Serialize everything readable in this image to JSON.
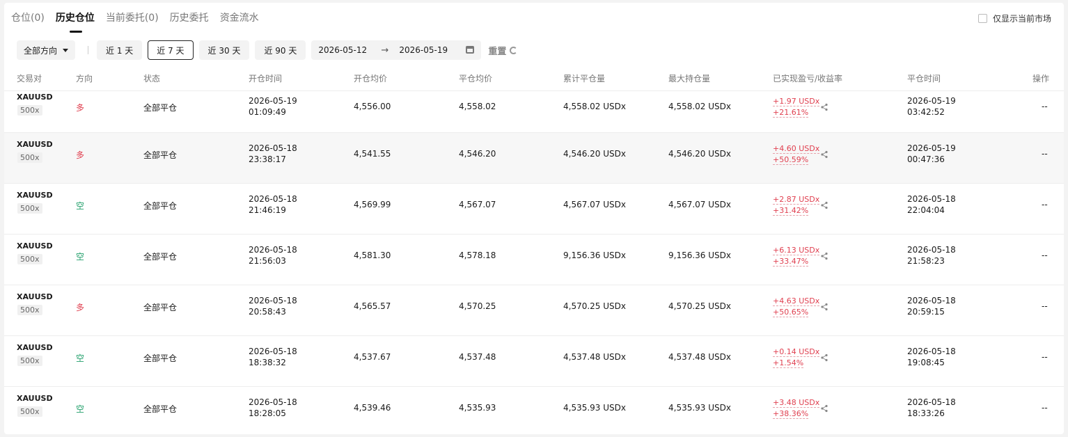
{
  "tabs": [
    {
      "label": "仓位(0)",
      "active": false
    },
    {
      "label": "历史仓位",
      "active": true
    },
    {
      "label": "当前委托(0)",
      "active": false
    },
    {
      "label": "历史委托",
      "active": false
    },
    {
      "label": "资金流水",
      "active": false
    }
  ],
  "only_current_market": {
    "label": "仅显示当前市场",
    "checked": false
  },
  "filters": {
    "direction": "全部方向",
    "ranges": [
      "近 1 天",
      "近 7 天",
      "近 30 天",
      "近 90 天"
    ],
    "active_range": "近 7 天",
    "date_from": "2026-05-12",
    "date_to": "2026-05-19",
    "reset_label": "重置"
  },
  "columns": [
    "交易对",
    "方向",
    "状态",
    "开仓时间",
    "开仓均价",
    "平仓均价",
    "累计平仓量",
    "最大持仓量",
    "已实现盈亏/收益率",
    "平仓时间",
    "操作"
  ],
  "rows": [
    {
      "pair": "XAUUSD",
      "leverage": "500x",
      "side": "多",
      "status": "全部平仓",
      "open_date": "2026-05-19",
      "open_time": "01:09:49",
      "open_price": "4,556.00",
      "close_price": "4,558.02",
      "closed_qty": "4,558.02 USDx",
      "max_qty": "4,558.02 USDx",
      "pnl": "+1.97 USDx",
      "roi": "+21.61%",
      "close_date": "2026-05-19",
      "close_time": "03:42:52",
      "action": "--"
    },
    {
      "pair": "XAUUSD",
      "leverage": "500x",
      "side": "多",
      "status": "全部平仓",
      "open_date": "2026-05-18",
      "open_time": "23:38:17",
      "open_price": "4,541.55",
      "close_price": "4,546.20",
      "closed_qty": "4,546.20 USDx",
      "max_qty": "4,546.20 USDx",
      "pnl": "+4.60 USDx",
      "roi": "+50.59%",
      "close_date": "2026-05-19",
      "close_time": "00:47:36",
      "action": "--"
    },
    {
      "pair": "XAUUSD",
      "leverage": "500x",
      "side": "空",
      "status": "全部平仓",
      "open_date": "2026-05-18",
      "open_time": "21:46:19",
      "open_price": "4,569.99",
      "close_price": "4,567.07",
      "closed_qty": "4,567.07 USDx",
      "max_qty": "4,567.07 USDx",
      "pnl": "+2.87 USDx",
      "roi": "+31.42%",
      "close_date": "2026-05-18",
      "close_time": "22:04:04",
      "action": "--"
    },
    {
      "pair": "XAUUSD",
      "leverage": "500x",
      "side": "空",
      "status": "全部平仓",
      "open_date": "2026-05-18",
      "open_time": "21:56:03",
      "open_price": "4,581.30",
      "close_price": "4,578.18",
      "closed_qty": "9,156.36 USDx",
      "max_qty": "9,156.36 USDx",
      "pnl": "+6.13 USDx",
      "roi": "+33.47%",
      "close_date": "2026-05-18",
      "close_time": "21:58:23",
      "action": "--"
    },
    {
      "pair": "XAUUSD",
      "leverage": "500x",
      "side": "多",
      "status": "全部平仓",
      "open_date": "2026-05-18",
      "open_time": "20:58:43",
      "open_price": "4,565.57",
      "close_price": "4,570.25",
      "closed_qty": "4,570.25 USDx",
      "max_qty": "4,570.25 USDx",
      "pnl": "+4.63 USDx",
      "roi": "+50.65%",
      "close_date": "2026-05-18",
      "close_time": "20:59:15",
      "action": "--"
    },
    {
      "pair": "XAUUSD",
      "leverage": "500x",
      "side": "空",
      "status": "全部平仓",
      "open_date": "2026-05-18",
      "open_time": "18:38:32",
      "open_price": "4,537.67",
      "close_price": "4,537.48",
      "closed_qty": "4,537.48 USDx",
      "max_qty": "4,537.48 USDx",
      "pnl": "+0.14 USDx",
      "roi": "+1.54%",
      "close_date": "2026-05-18",
      "close_time": "19:08:45",
      "action": "--"
    },
    {
      "pair": "XAUUSD",
      "leverage": "500x",
      "side": "空",
      "status": "全部平仓",
      "open_date": "2026-05-18",
      "open_time": "18:28:05",
      "open_price": "4,539.46",
      "close_price": "4,535.93",
      "closed_qty": "4,535.93 USDx",
      "max_qty": "4,535.93 USDx",
      "pnl": "+3.48 USDx",
      "roi": "+38.36%",
      "close_date": "2026-05-18",
      "close_time": "18:33:26",
      "action": "--"
    }
  ],
  "colors": {
    "long": "#e04050",
    "short": "#22a06b",
    "profit": "#e04050"
  }
}
